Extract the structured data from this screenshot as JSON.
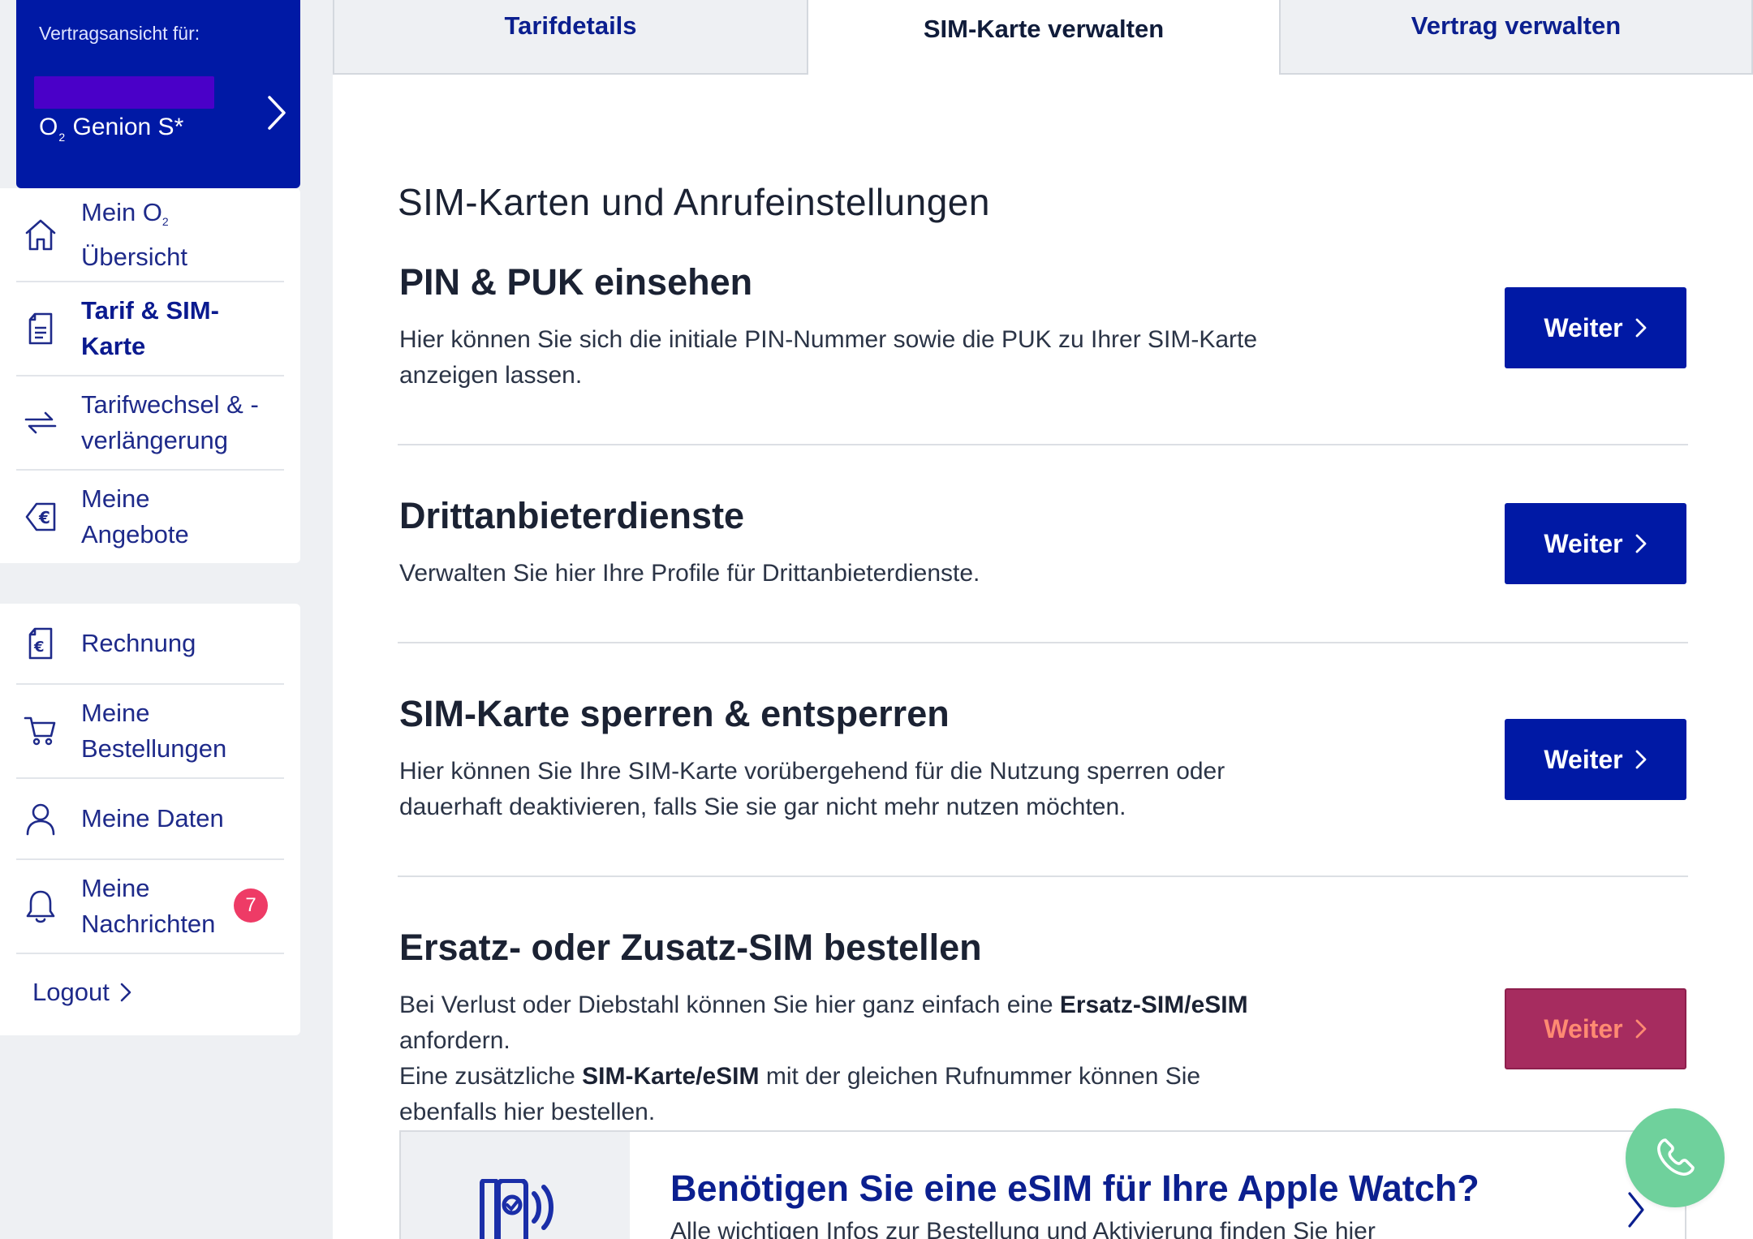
{
  "sidebar": {
    "contract_label": "Vertragsansicht für:",
    "tariff_prefix": "O",
    "tariff_sub": "2",
    "tariff_suffix": "Genion S*",
    "items_group1": [
      {
        "line1": "Mein O",
        "line1_sub": "2",
        "line2": "Übersicht",
        "icon": "home-icon",
        "active": false
      },
      {
        "line1": "Tarif & SIM-",
        "line2": "Karte",
        "icon": "document-icon",
        "active": true
      },
      {
        "line1": "Tarifwechsel & -",
        "line2": "verlängerung",
        "icon": "swap-arrows-icon",
        "active": false
      },
      {
        "line1": "Meine",
        "line2": "Angebote",
        "icon": "euro-tag-icon",
        "active": false
      }
    ],
    "items_group2": [
      {
        "line1": "Rechnung",
        "icon": "euro-invoice-icon"
      },
      {
        "line1": "Meine",
        "line2": "Bestellungen",
        "icon": "shopping-cart-icon"
      },
      {
        "line1": "Meine Daten",
        "icon": "user-icon"
      },
      {
        "line1": "Meine",
        "line2": "Nachrichten",
        "icon": "bell-icon",
        "badge": "7"
      }
    ],
    "logout": "Logout"
  },
  "tabs": [
    {
      "label": "Tarifdetails",
      "active": false
    },
    {
      "label": "SIM-Karte verwalten",
      "active": true
    },
    {
      "label": "Vertrag verwalten",
      "active": false
    }
  ],
  "main": {
    "heading": "SIM-Karten und Anrufeinstellungen",
    "button_label": "Weiter",
    "cards": [
      {
        "title": "PIN & PUK einsehen",
        "desc_line1": "Hier können Sie sich die initiale PIN-Nummer sowie die PUK zu Ihrer SIM-Karte",
        "desc_line2": "anzeigen lassen."
      },
      {
        "title": "Drittanbieterdienste",
        "desc_line1": "Verwalten Sie hier Ihre Profile für Drittanbieterdienste."
      },
      {
        "title": "SIM-Karte sperren & entsperren",
        "desc_line1": "Hier können Sie Ihre SIM-Karte vorübergehend für die Nutzung sperren oder",
        "desc_line2": "dauerhaft deaktivieren, falls Sie sie gar nicht mehr nutzen möchten."
      },
      {
        "title": "Ersatz- oder Zusatz-SIM bestellen",
        "desc_a": "Bei Verlust oder Diebstahl können Sie hier ganz einfach eine ",
        "desc_a_bold": "Ersatz-SIM/eSIM",
        "desc_b": "anfordern.",
        "desc_c": "Eine zusätzliche ",
        "desc_c_bold": "SIM-Karte/eSIM",
        "desc_c_rest": " mit der gleichen Rufnummer können Sie",
        "desc_d": "ebenfalls hier bestellen."
      }
    ],
    "promo": {
      "title": "Benötigen Sie eine eSIM für Ihre Apple Watch?",
      "text": "Alle wichtigen Infos zur Bestellung und Aktivierung finden Sie hier"
    }
  },
  "colors": {
    "brand_blue": "#0019a5",
    "focused_button": "#a62c5f",
    "badge": "#ee3b66",
    "call_button": "#6fd19c"
  }
}
